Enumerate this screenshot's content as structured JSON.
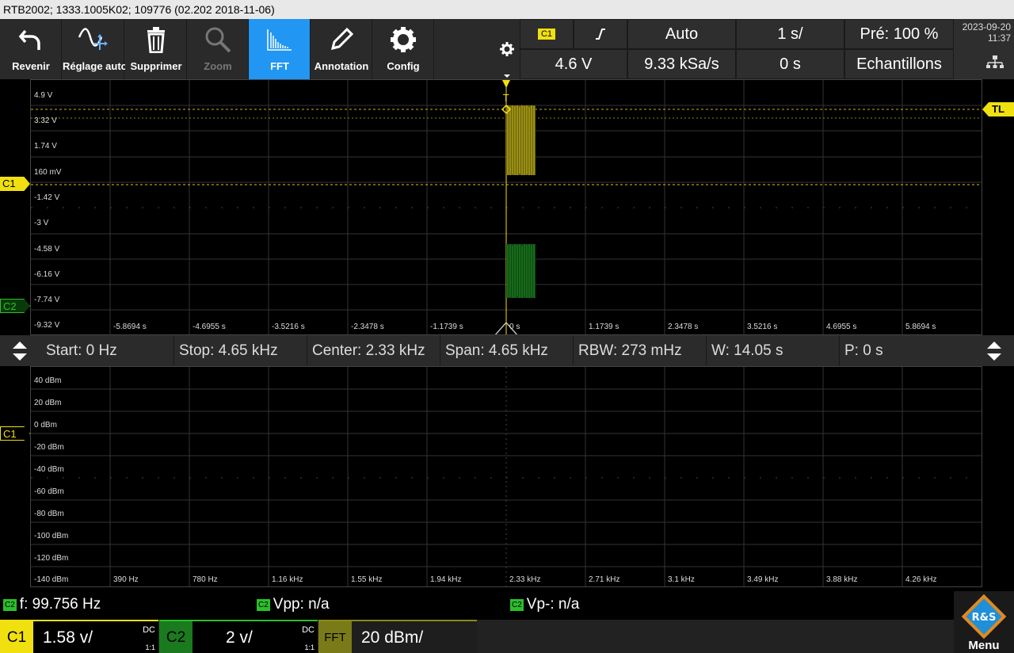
{
  "title": "RTB2002; 1333.1005K02; 109776 (02.202 2018-11-06)",
  "toolbar": {
    "items": [
      {
        "label": "Revenir",
        "icon": "undo-icon"
      },
      {
        "label": "Réglage auto",
        "icon": "autoset-icon"
      },
      {
        "label": "Supprimer",
        "icon": "trash-icon"
      },
      {
        "label": "Zoom",
        "icon": "zoom-icon"
      },
      {
        "label": "FFT",
        "icon": "fft-icon"
      },
      {
        "label": "Annotation",
        "icon": "pencil-icon"
      },
      {
        "label": "Config",
        "icon": "gear-icon"
      }
    ]
  },
  "trigger": {
    "source": "C1",
    "slope_icon": "rising-edge-icon",
    "mode": "Auto",
    "timebase": "1 s/",
    "pretrigger": "Pré: 100 %",
    "level": "4.6 V",
    "sample_rate": "9.33 kSa/s",
    "position": "0 s",
    "acq_mode": "Echantillons"
  },
  "datetime": {
    "date": "2023-09-20",
    "time": "11:37"
  },
  "scope": {
    "y_labels": [
      "4.9 V",
      "3.32 V",
      "1.74 V",
      "160 mV",
      "-1.42 V",
      "-3 V",
      "-4.58 V",
      "-6.16 V",
      "-7.74 V",
      "-9.32 V"
    ],
    "x_labels": [
      "-5.8694 s",
      "-4.6955 s",
      "-3.5216 s",
      "-2.3478 s",
      "-1.1739 s",
      "0 s",
      "1.1739 s",
      "2.3478 s",
      "3.5216 s",
      "4.6955 s",
      "5.8694 s"
    ],
    "markers": {
      "c1": "C1",
      "c2": "C2",
      "tl": "TL"
    },
    "colors": {
      "c1": "#f0e010",
      "c2": "#2bbf2b",
      "trigger": "#f0e010"
    }
  },
  "fft": {
    "start": "Start: 0 Hz",
    "stop": "Stop: 4.65 kHz",
    "center": "Center: 2.33 kHz",
    "span": "Span: 4.65 kHz",
    "rbw": "RBW: 273 mHz",
    "window": "W: 14.05 s",
    "pos": "P: 0 s",
    "y_labels": [
      "40 dBm",
      "20 dBm",
      "0 dBm",
      "-20 dBm",
      "-40 dBm",
      "-60 dBm",
      "-80 dBm",
      "-100 dBm",
      "-120 dBm",
      "-140 dBm"
    ],
    "x_labels": [
      "390 Hz",
      "780 Hz",
      "1.16 kHz",
      "1.55 kHz",
      "1.94 kHz",
      "2.33 kHz",
      "2.71 kHz",
      "3.1 kHz",
      "3.49 kHz",
      "3.88 kHz",
      "4.26 kHz"
    ],
    "marker": "C1"
  },
  "measurements": [
    {
      "tag": "C2",
      "text": "f: 99.756 Hz"
    },
    {
      "tag": "C2",
      "text": "Vpp: n/a"
    },
    {
      "tag": "C2",
      "text": "Vp-: n/a"
    }
  ],
  "channels": {
    "c1": {
      "name": "C1",
      "scale": "1.58 v/",
      "coupling": "DC",
      "probe": "1:1",
      "color": "#f0e010"
    },
    "c2": {
      "name": "C2",
      "scale": "2 v/",
      "coupling": "DC",
      "probe": "1:1",
      "color": "#2bbf2b"
    },
    "fft": {
      "name": "FFT",
      "scale": "20 dBm/",
      "color": "#8a8a1a"
    }
  },
  "menu": {
    "label": "Menu",
    "logo_text": "R&S"
  }
}
